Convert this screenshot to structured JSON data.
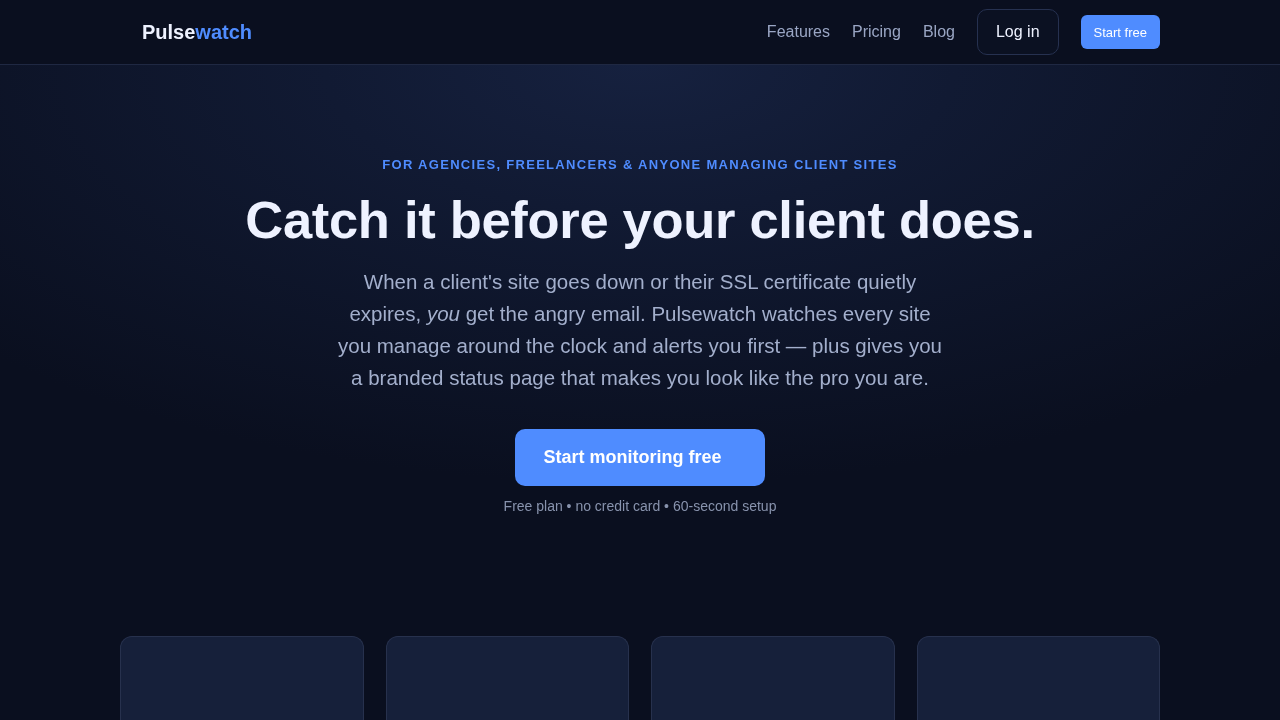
{
  "nav": {
    "logo": {
      "text": "Pulse",
      "highlight": "watch"
    },
    "links": [
      "Features",
      "Pricing",
      "Blog"
    ],
    "login": "Log in",
    "signup": "Start free"
  },
  "hero": {
    "eyebrow": "FOR AGENCIES, FREELANCERS & ANYONE MANAGING CLIENT SITES",
    "headline": "Catch it before your client does.",
    "body": "When a client's site goes down or their SSL certificate quietly expires, *you* get the angry email. Pulsewatch watches every site you manage around the clock and alerts you first — plus gives you a branded status page that makes you look like the pro you are.",
    "cta": "Start monitoring free",
    "note": "Free plan • no credit card • 60-second setup"
  },
  "cards": [
    {
      "kind": "blank"
    },
    {
      "kind": "blank"
    },
    {
      "kind": "blank"
    },
    {
      "kind": "blank"
    }
  ]
}
